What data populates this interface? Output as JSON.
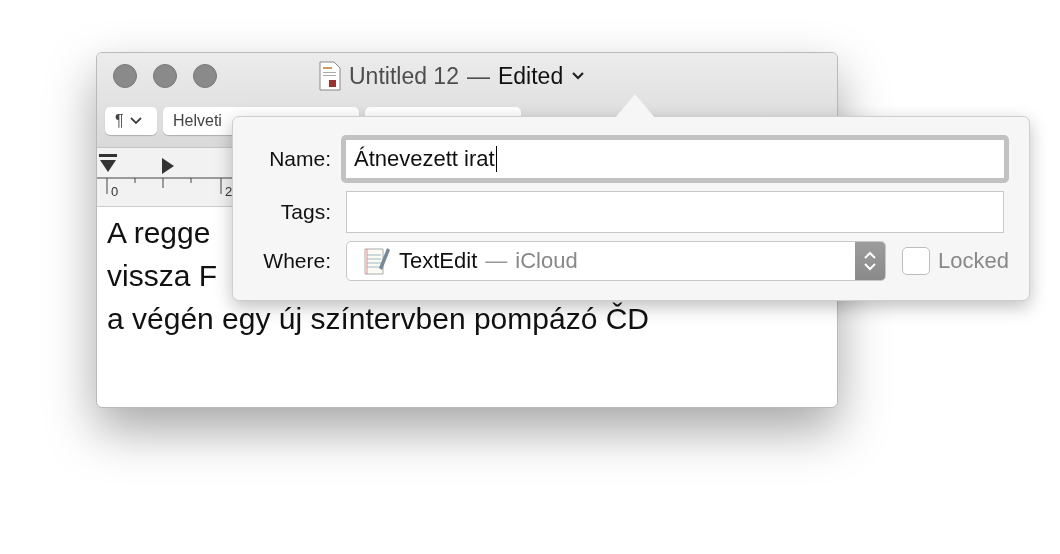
{
  "window": {
    "title": "Untitled 12",
    "separator": "—",
    "status": "Edited"
  },
  "toolbar": {
    "paragraph_button": "¶",
    "font_field": "Helveti"
  },
  "ruler": {
    "labels": [
      "0",
      "2"
    ]
  },
  "document": {
    "lines": [
      "A regge",
      "vissza F",
      "a végén egy új színtervben pompázó ČD"
    ]
  },
  "rename_popover": {
    "name_label": "Name:",
    "name_value": "Átnevezett irat",
    "tags_label": "Tags:",
    "where_label": "Where:",
    "where_app": "TextEdit",
    "where_separator": "—",
    "where_location": "iCloud",
    "locked_label": "Locked",
    "locked": false
  }
}
